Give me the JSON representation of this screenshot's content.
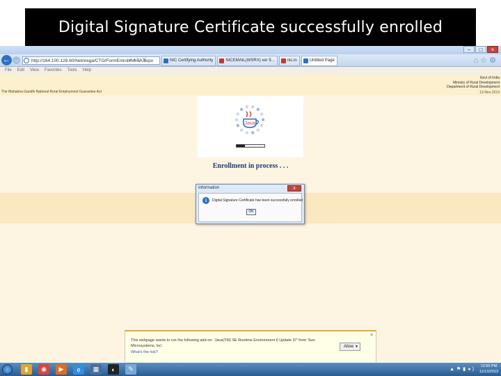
{
  "slide": {
    "title": "Digital Signature Certificate successfully enrolled"
  },
  "browser": {
    "address": "http://164.100.128.60/Netnrega/CTO/FormEntrollmentA.aspx",
    "tabs": [
      {
        "label": "NIC Certifying Authority",
        "icon_color": "#2f6fc4"
      },
      {
        "label": "NICEMAIL(WSRX) ver 5...",
        "icon_color": "#c0392b"
      },
      {
        "label": "nic.in",
        "icon_color": "#c0392b"
      },
      {
        "label": "Untitled Page",
        "icon_color": "#2f6fc4",
        "active": true
      }
    ],
    "menu": [
      "File",
      "Edit",
      "View",
      "Favorites",
      "Tools",
      "Help"
    ]
  },
  "header": {
    "left": "The Mahatma Gandhi National Rural Employment Guarantee Act",
    "right_lines": [
      "Govt of India",
      "Ministry of Rural Development",
      "Department of Rural Development"
    ],
    "date": "13-Nov-2013"
  },
  "enrollment": {
    "status": "Enrollment in process . . .",
    "progress": 0.3
  },
  "dialog": {
    "title": "Information",
    "message": "Digital Signature Certificate has been successfully enrolled",
    "ok": "OK"
  },
  "infobar": {
    "message": "This webpage wants to run the following add-on: 'Java(TM) SE Runtime Environment 6 Update 37' from 'Sun Microsystems, Inc'.",
    "link": "What's the risk?",
    "allow": "Allow"
  },
  "taskbar": {
    "time": "12:50 PM",
    "date": "11/13/2013",
    "apps": [
      {
        "icon": "folder-icon",
        "color": "#e0a52a"
      },
      {
        "icon": "chrome-icon",
        "color": "#d9453b"
      },
      {
        "icon": "media-player-icon",
        "color": "#e56a1f"
      },
      {
        "icon": "internet-explorer-icon",
        "color": "#2f8fd8"
      },
      {
        "icon": "file-explorer-icon",
        "color": "#4a6e9a"
      },
      {
        "icon": "pinned-app-icon",
        "color": "#222222"
      },
      {
        "icon": "paint-icon",
        "color": "#7aa8d6"
      }
    ]
  }
}
